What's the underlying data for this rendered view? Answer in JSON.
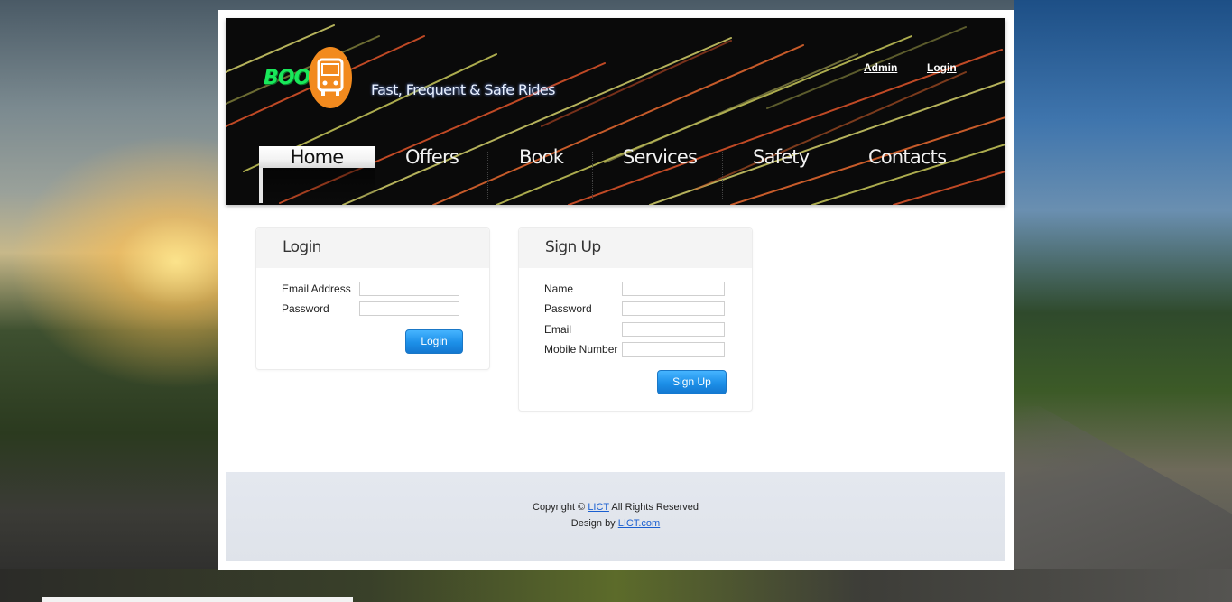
{
  "header": {
    "logo_text": "BOOK",
    "tagline": "Fast, Frequent & Safe Rides",
    "top_links": {
      "admin": "Admin",
      "login": "Login"
    },
    "nav": [
      "Home",
      "Offers",
      "Book",
      "Services",
      "Safety",
      "Contacts"
    ],
    "active_nav": "Home"
  },
  "login_panel": {
    "title": "Login",
    "fields": [
      {
        "label": "Email Address",
        "value": ""
      },
      {
        "label": "Password",
        "value": ""
      }
    ],
    "button": "Login"
  },
  "signup_panel": {
    "title": "Sign Up",
    "fields": [
      {
        "label": "Name",
        "value": ""
      },
      {
        "label": "Password",
        "value": ""
      },
      {
        "label": "Email",
        "value": ""
      },
      {
        "label": "Mobile Number",
        "value": ""
      }
    ],
    "button": "Sign Up"
  },
  "footer": {
    "copyright_prefix": "Copyright ©",
    "copyright_link": "LICT",
    "copyright_suffix": "All Rights Reserved",
    "design_prefix": "Design by",
    "design_link": "LICT.com"
  },
  "colors": {
    "accent_button": "#1c8fe8",
    "logo_green": "#19e85a",
    "logo_badge": "#f28a1e",
    "link_blue": "#1a5fd0"
  }
}
